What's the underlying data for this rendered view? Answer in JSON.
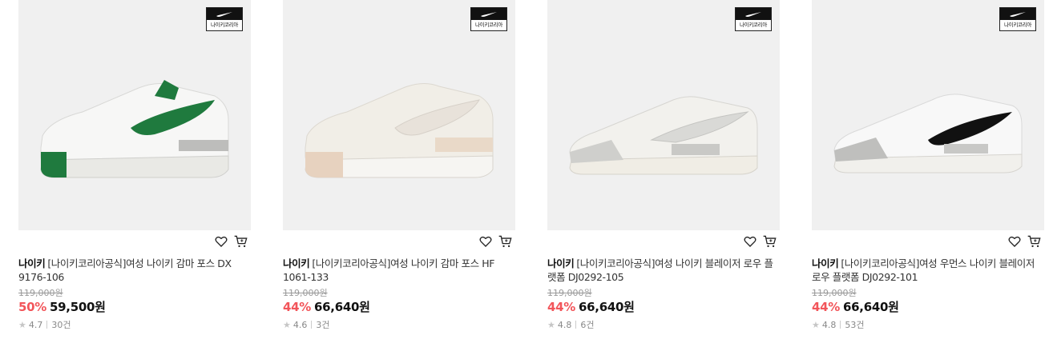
{
  "products": [
    {
      "badge_text": "나이키코리아",
      "brand": "나이키",
      "name": "[나이키코리아공식]여성 나이키 감마 포스 DX 9176-106",
      "original_price": "119,000원",
      "discount_rate": "50%",
      "sale_price": "59,500원",
      "rating": "4.7",
      "review_count": "30건",
      "shoe_colors": {
        "upper": "#f7f7f6",
        "accent": "#1f7a3e",
        "sole": "#e9e9e5",
        "heel": "#1f7a3e"
      }
    },
    {
      "badge_text": "나이키코리아",
      "brand": "나이키",
      "name": "[나이키코리아공식]여성 나이키 감마 포스 HF 1061-133",
      "original_price": "119,000원",
      "discount_rate": "44%",
      "sale_price": "66,640원",
      "rating": "4.6",
      "review_count": "3건",
      "shoe_colors": {
        "upper": "#f1eee7",
        "accent": "#e8e2da",
        "sole": "#f6f5f2",
        "heel": "#e7d2bf"
      }
    },
    {
      "badge_text": "나이키코리아",
      "brand": "나이키",
      "name": "[나이키코리아공식]여성 나이키 블레이저 로우 플랫폼 DJ0292-105",
      "original_price": "119,000원",
      "discount_rate": "44%",
      "sale_price": "66,640원",
      "rating": "4.8",
      "review_count": "6건",
      "shoe_colors": {
        "upper": "#f2f1ed",
        "accent": "#d9d9d6",
        "sole": "#f0ede5",
        "heel": "#cfcfcc"
      }
    },
    {
      "badge_text": "나이키코리아",
      "brand": "나이키",
      "name": "[나이키코리아공식]여성 우먼스 나이키 블레이저 로우 플랫폼 DJ0292-101",
      "original_price": "119,000원",
      "discount_rate": "44%",
      "sale_price": "66,640원",
      "rating": "4.8",
      "review_count": "53건",
      "shoe_colors": {
        "upper": "#f8f8f8",
        "accent": "#111111",
        "sole": "#f1f0ec",
        "heel": "#bfbfbd"
      }
    }
  ],
  "icons": {
    "wishlist": "heart-icon",
    "cart": "cart-icon",
    "star": "star-icon",
    "badge_logo": "nike-swoosh-icon"
  },
  "colors": {
    "discount": "#f2555a",
    "thumb_bg": "#f0f0f0"
  }
}
